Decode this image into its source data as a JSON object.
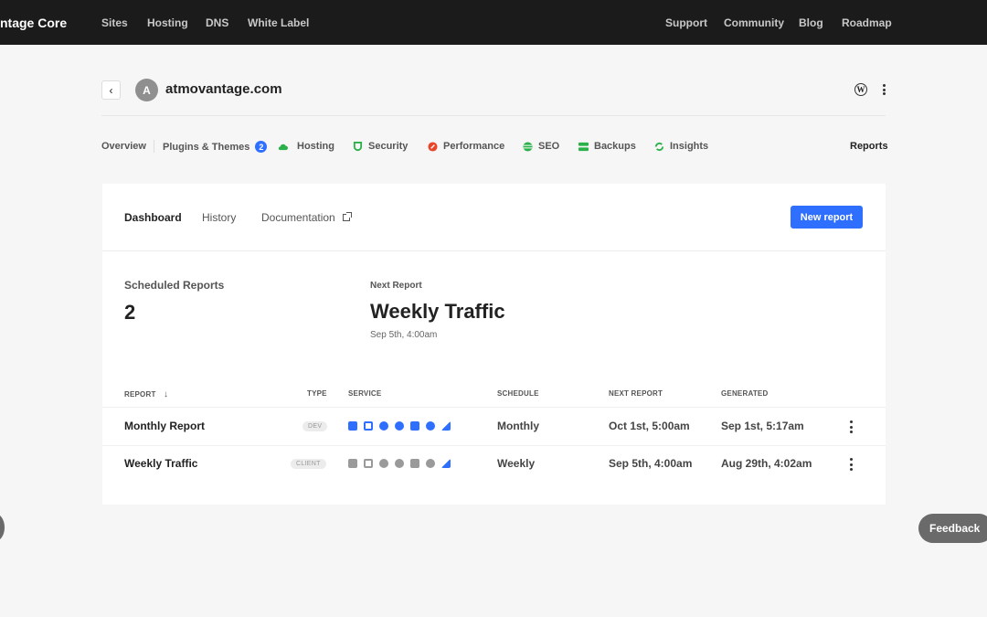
{
  "topbar": {
    "brand": "ntage Core",
    "left_links": [
      "Sites",
      "Hosting",
      "DNS",
      "White Label"
    ],
    "right_links": [
      "Support",
      "Community",
      "Blog",
      "Roadmap"
    ]
  },
  "site": {
    "avatar_letter": "A",
    "name": "atmovantage.com",
    "back_glyph": "‹"
  },
  "section_nav": {
    "items": [
      {
        "label": "Overview"
      },
      {
        "label": "Plugins & Themes",
        "badge": "2"
      },
      {
        "label": "Hosting",
        "icon": "cloud-icon",
        "color": "#2bb14a"
      },
      {
        "label": "Security",
        "icon": "shield-icon",
        "color": "#2bb14a"
      },
      {
        "label": "Performance",
        "icon": "speed-icon",
        "color": "#e8452c"
      },
      {
        "label": "SEO",
        "icon": "seo-icon",
        "color": "#2bb14a"
      },
      {
        "label": "Backups",
        "icon": "backups-icon",
        "color": "#2bb14a"
      },
      {
        "label": "Insights",
        "icon": "insights-icon",
        "color": "#2bb14a"
      }
    ],
    "active": "Reports"
  },
  "tabs": {
    "dashboard": "Dashboard",
    "history": "History",
    "documentation": "Documentation",
    "new_report": "New report"
  },
  "stats": {
    "scheduled_label": "Scheduled Reports",
    "scheduled_value": "2",
    "next_label": "Next Report",
    "next_value": "Weekly Traffic",
    "next_time": "Sep 5th, 4:00am"
  },
  "table": {
    "headers": {
      "report": "Report",
      "sort_glyph": "↓",
      "type": "Type",
      "service": "Service",
      "schedule": "Schedule",
      "next_report": "Next Report",
      "generated": "Generated"
    },
    "rows": [
      {
        "name": "Monthly Report",
        "type": "DEV",
        "schedule": "Monthly",
        "next": "Oct 1st, 5:00am",
        "generated": "Sep 1st, 5:17am",
        "service_color": "#2f6fff"
      },
      {
        "name": "Weekly Traffic",
        "type": "CLIENT",
        "schedule": "Weekly",
        "next": "Sep 5th, 4:00am",
        "generated": "Aug 29th, 4:02am",
        "service_color": "#9a9a9a"
      }
    ]
  },
  "feedback": "Feedback",
  "colors": {
    "accent": "#2f6fff",
    "topbar": "#1b1b1b",
    "ok": "#2bb14a",
    "warn": "#e8452c"
  }
}
